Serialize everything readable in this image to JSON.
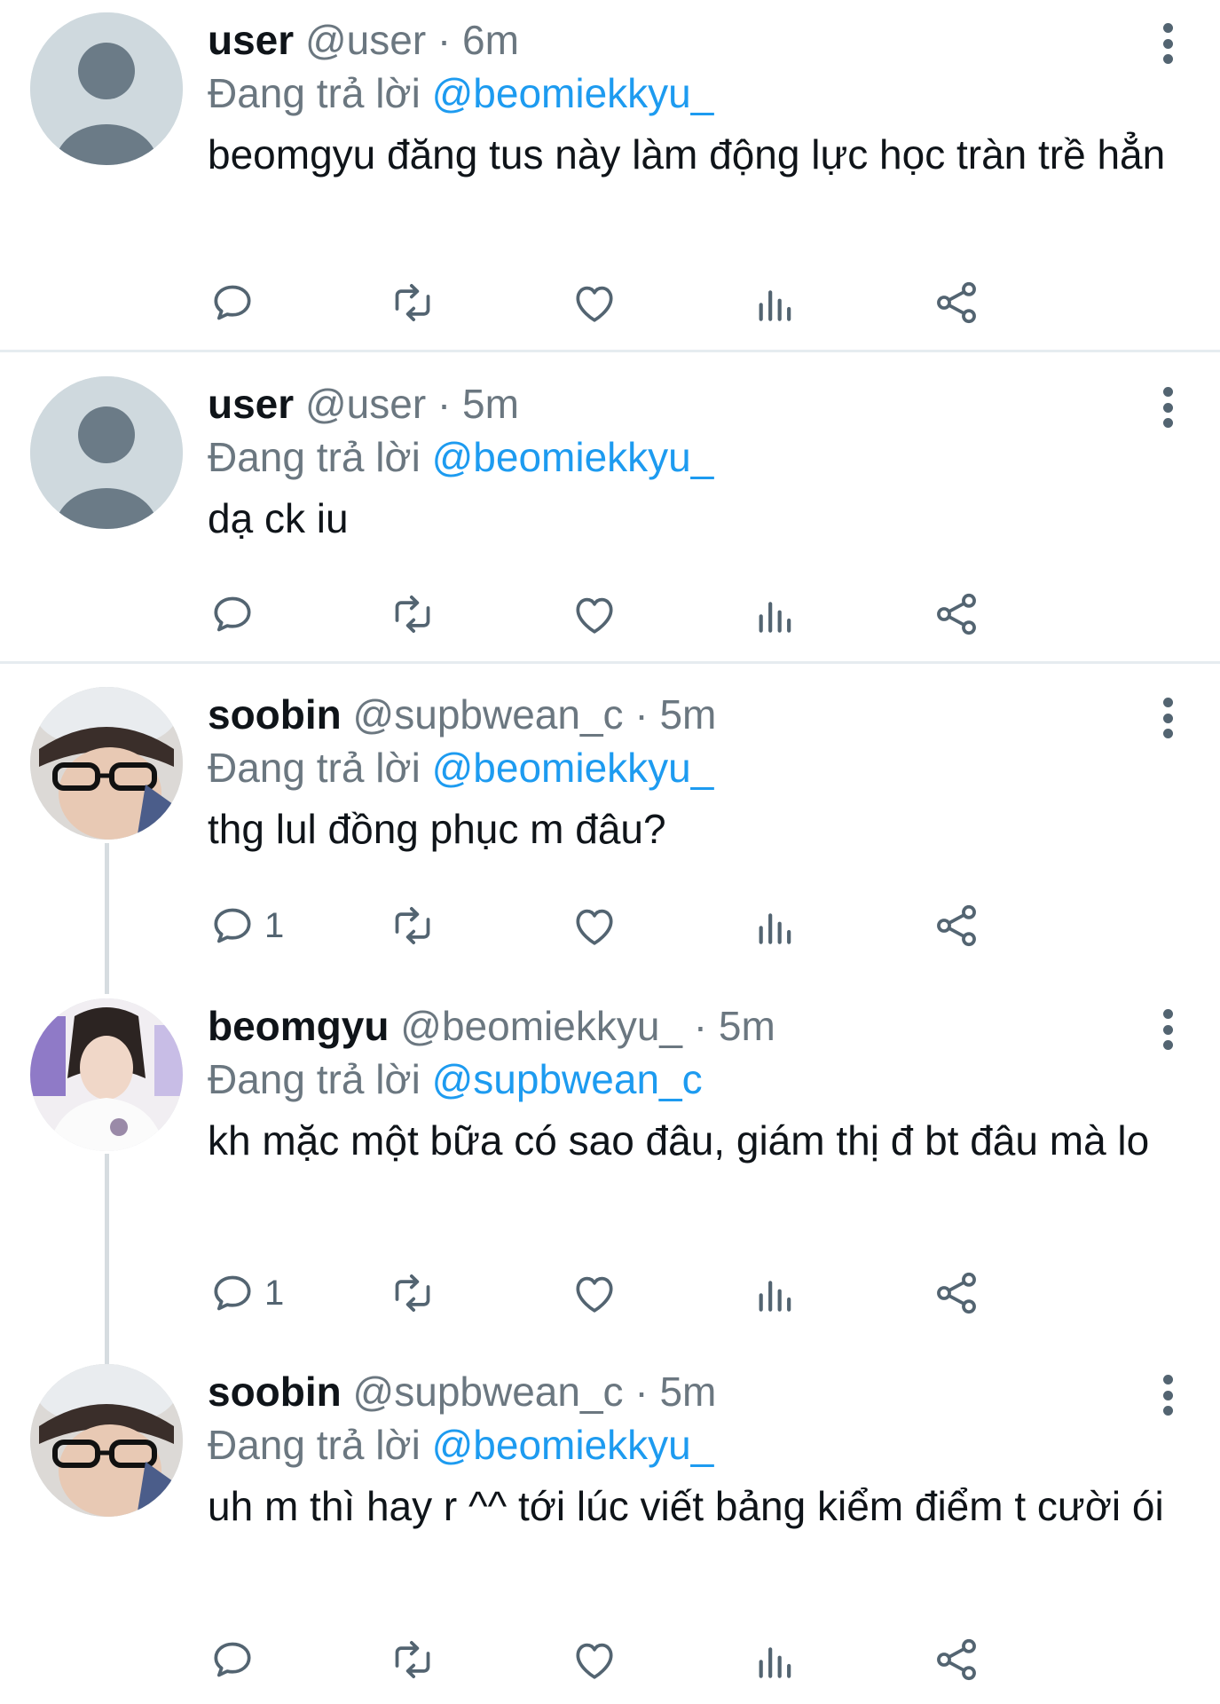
{
  "tweets": [
    {
      "name": "user",
      "handle": "@user",
      "time": "6m",
      "replying_label": "Đang trả lời",
      "replying_to": "@beomiekkyu_",
      "text": "beomgyu đăng tus này làm động lực học tràn trề hẳn",
      "reply_count": "",
      "avatar": "default-avatar"
    },
    {
      "name": "user",
      "handle": "@user",
      "time": "5m",
      "replying_label": "Đang trả lời",
      "replying_to": "@beomiekkyu_",
      "text": "dạ ck iu",
      "reply_count": "",
      "avatar": "default-avatar"
    },
    {
      "name": "soobin",
      "handle": "@supbwean_c",
      "time": "5m",
      "replying_label": "Đang trả lời",
      "replying_to": "@beomiekkyu_",
      "text": "thg lul đồng phục m đâu?",
      "reply_count": "1",
      "avatar": "photo-avatar"
    },
    {
      "name": "beomgyu",
      "handle": "@beomiekkyu_",
      "time": "5m",
      "replying_label": "Đang trả lời",
      "replying_to": "@supbwean_c",
      "text": "kh mặc một bữa có sao đâu, giám thị đ bt đâu mà lo",
      "reply_count": "1",
      "avatar": "photo-avatar"
    },
    {
      "name": "soobin",
      "handle": "@supbwean_c",
      "time": "5m",
      "replying_label": "Đang trả lời",
      "replying_to": "@beomiekkyu_",
      "text": "uh m thì hay r ^^ tới lúc viết bảng kiểm điểm t cười ói",
      "reply_count": "",
      "avatar": "photo-avatar"
    }
  ],
  "separator": " · ",
  "icons": {
    "reply": "reply-icon",
    "retweet": "retweet-icon",
    "like": "heart-icon",
    "views": "views-icon",
    "share": "share-icon",
    "more": "more-options-icon"
  },
  "colors": {
    "mention": "#1d9bf0",
    "secondary_text": "#6b7780",
    "icon": "#536471",
    "divider": "#e6ecf0",
    "thread_line": "#d6dce0"
  }
}
